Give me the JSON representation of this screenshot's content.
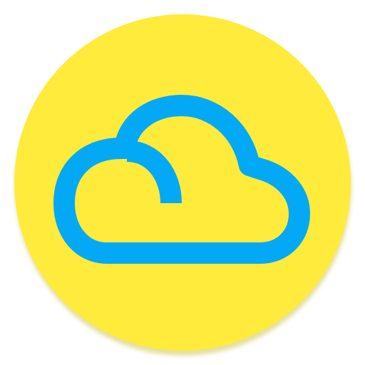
{
  "app_icon": {
    "icon": "cloud-icon",
    "background_shape": "circle",
    "colors": {
      "background": "#FFEB3B",
      "cloud_stroke": "#03A9F4",
      "shadow": "#C8B92E"
    }
  }
}
